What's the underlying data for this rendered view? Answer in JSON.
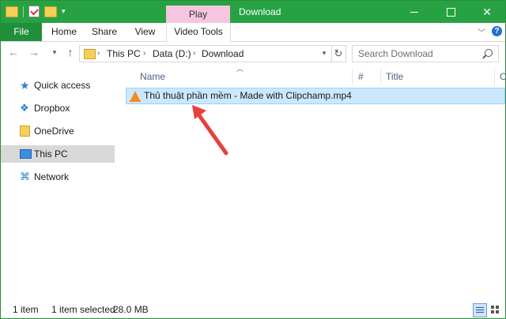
{
  "window": {
    "title": "Download",
    "context_tab": "Play"
  },
  "ribbon": {
    "tabs": [
      "File",
      "Home",
      "Share",
      "View",
      "Video Tools"
    ]
  },
  "nav": {
    "breadcrumb": [
      "This PC",
      "Data (D:)",
      "Download"
    ],
    "search_placeholder": "Search Download"
  },
  "sidebar": {
    "items": [
      {
        "label": "Quick access",
        "icon": "star-icon"
      },
      {
        "label": "Dropbox",
        "icon": "dropbox-icon"
      },
      {
        "label": "OneDrive",
        "icon": "onedrive-icon"
      },
      {
        "label": "This PC",
        "icon": "computer-icon",
        "selected": true
      },
      {
        "label": "Network",
        "icon": "network-icon"
      }
    ]
  },
  "columns": {
    "name": "Name",
    "number": "#",
    "title": "Title",
    "extra": "C"
  },
  "files": [
    {
      "name": "Thủ thuật phần mềm - Made with Clipchamp.mp4",
      "icon": "vlc-icon",
      "selected": true
    }
  ],
  "status": {
    "count": "1 item",
    "selection": "1 item selected",
    "size": "28.0 MB"
  },
  "colors": {
    "titlebar": "#27a243",
    "file_tab": "#1f8f3a",
    "context_tab": "#f6c6e0",
    "selection": "#cce8ff",
    "annotation": "#e8403a"
  }
}
